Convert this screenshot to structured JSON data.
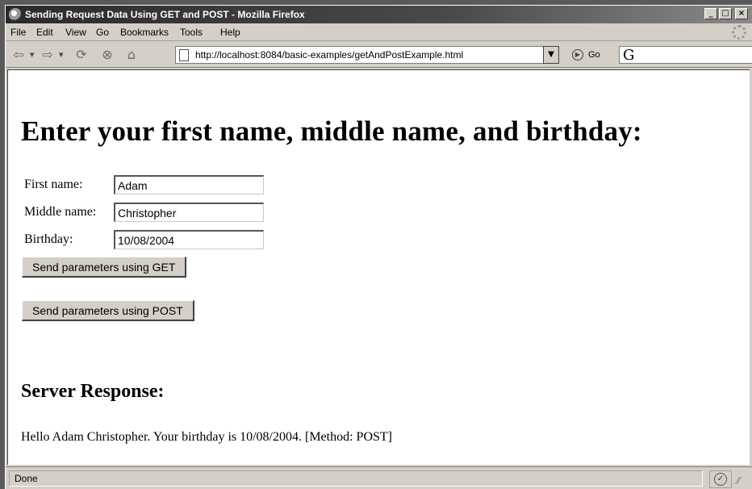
{
  "window": {
    "title": "Sending Request Data Using GET and POST - Mozilla Firefox",
    "minimize_glyph": "_",
    "maximize_glyph": "□",
    "close_glyph": "×"
  },
  "menu": [
    {
      "label": "File"
    },
    {
      "label": "Edit"
    },
    {
      "label": "View"
    },
    {
      "label": "Go"
    },
    {
      "label": "Bookmarks"
    },
    {
      "label": "Tools"
    },
    {
      "label": "Help"
    }
  ],
  "navbar": {
    "url": "http://localhost:8084/basic-examples/getAndPostExample.html",
    "go_label": "Go",
    "search_glyph": "G",
    "icons": [
      "back-icon",
      "forward-icon",
      "reload-icon",
      "stop-icon",
      "home-icon"
    ]
  },
  "page": {
    "heading": "Enter your first name, middle name, and birthday:",
    "first_name_label": "First name:",
    "first_name_value": "Adam",
    "middle_name_label": "Middle name:",
    "middle_name_value": "Christopher",
    "birthday_label": "Birthday:",
    "birthday_value": "10/08/2004",
    "get_button": "Send parameters using GET",
    "post_button": "Send parameters using POST",
    "response_heading": "Server Response:",
    "response_text": "Hello Adam Christopher. Your birthday is 10/08/2004. [Method: POST]"
  },
  "status": {
    "text": "Done"
  }
}
